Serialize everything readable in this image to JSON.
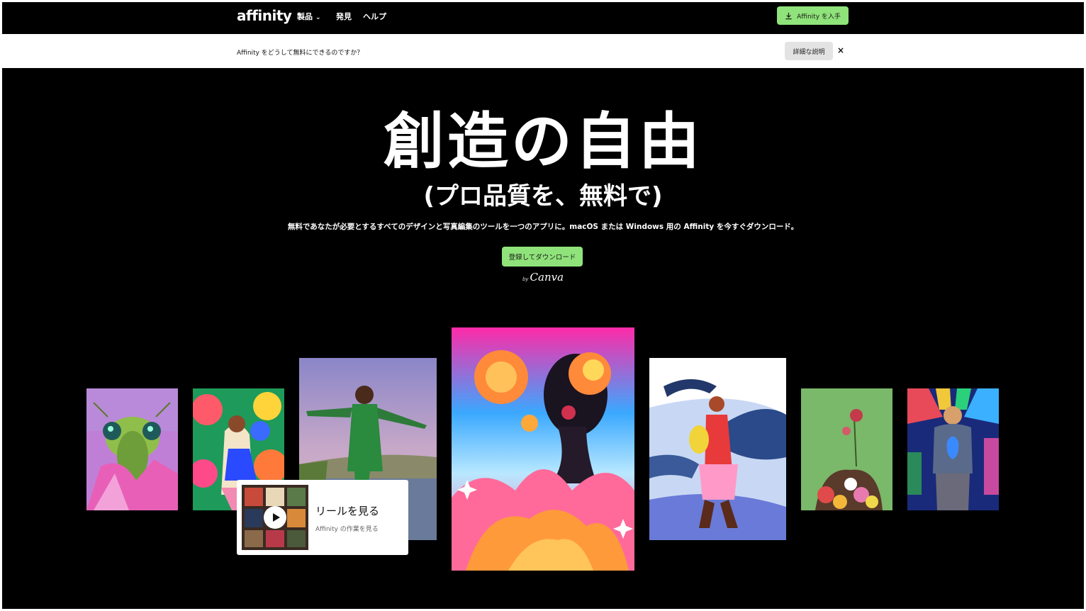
{
  "nav": {
    "logo": "affinity",
    "items": [
      {
        "label": "製品",
        "dropdown": true
      },
      {
        "label": "発見",
        "dropdown": false
      },
      {
        "label": "ヘルプ",
        "dropdown": false
      }
    ],
    "get_button": "Affinity を入手"
  },
  "banner": {
    "text": "Affinity をどうして無料にできるのですか？",
    "more_button": "詳細な説明",
    "close": "×"
  },
  "hero": {
    "title": "創造の自由",
    "subtitle": "(プロ品質を、無料で)",
    "description": "無料であなたが必要とするすべてのデザインと写真編集のツールを一つのアプリに。macOS または Windows 用の Affinity を今すぐダウンロード。",
    "cta": "登録してダウンロード",
    "by": "by",
    "brand": "Canva"
  },
  "reel": {
    "title": "リールを見る",
    "subtitle": "Affinity の作業を見る"
  },
  "colors": {
    "accent": "#8fe37a",
    "background": "#000000",
    "banner": "#ffffff"
  }
}
